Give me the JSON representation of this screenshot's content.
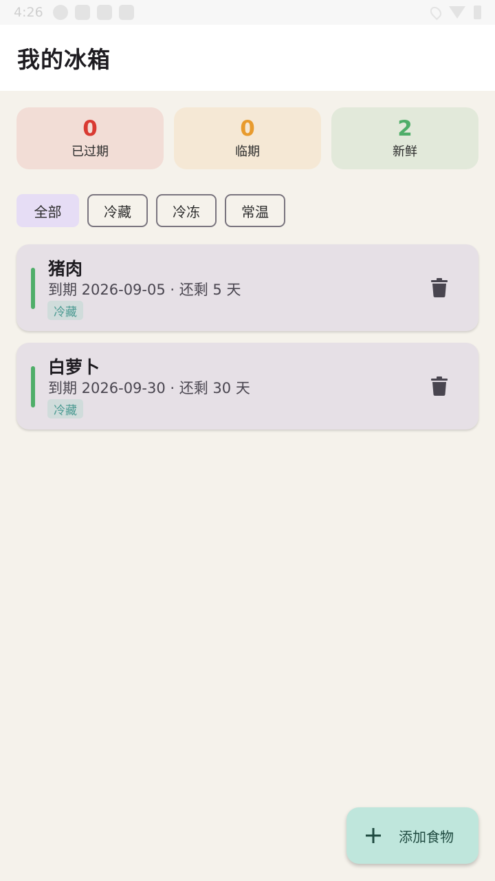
{
  "status_bar": {
    "time": "4:26"
  },
  "app_bar": {
    "title": "我的冰箱"
  },
  "stats": {
    "expired": {
      "count": "0",
      "label": "已过期",
      "color": "#d93a32"
    },
    "expiring": {
      "count": "0",
      "label": "临期",
      "color": "#e89b2e"
    },
    "fresh": {
      "count": "2",
      "label": "新鲜",
      "color": "#4fae69"
    }
  },
  "filters": [
    "全部",
    "冷藏",
    "冷冻",
    "常温"
  ],
  "foods": [
    {
      "name": "猪肉",
      "expiry": "到期 2026-09-05 · 还剩 5 天",
      "tag": "冷藏"
    },
    {
      "name": "白萝卜",
      "expiry": "到期 2026-09-30 · 还剩 30 天",
      "tag": "冷藏"
    }
  ],
  "fab": {
    "label": "添加食物",
    "icon": "plus-icon"
  },
  "icons": {
    "delete": "trash-icon"
  }
}
